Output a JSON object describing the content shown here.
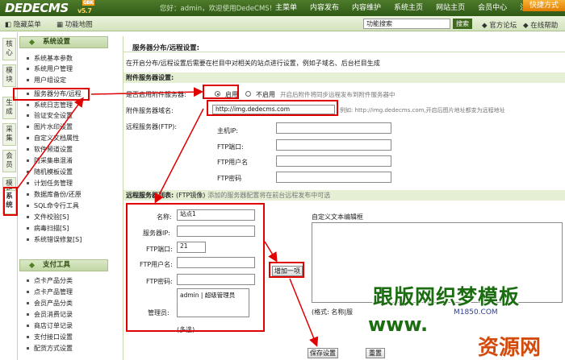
{
  "header": {
    "logo": "DEDECMS",
    "version": "v5.7",
    "badge": "GBK",
    "welcome": "您好：admin，欢迎使用DedeCMS!",
    "nav": [
      "主菜单",
      "内容发布",
      "内容维护",
      "系统主页",
      "网站主页",
      "会员中心",
      "注销"
    ],
    "quick_btn": "快捷方式"
  },
  "toolbar": {
    "hide_menu": "隐藏菜单",
    "func_map": "功能地图",
    "search_value": "功能搜索",
    "search_btn": "搜索",
    "forum": "官方论坛",
    "help": "在线帮助"
  },
  "vtabs": [
    "核心",
    "模块",
    "生成",
    "采集",
    "会员",
    "模板",
    "系统"
  ],
  "sidebar": {
    "sections": [
      {
        "title": "系统设置",
        "items": [
          "系统基本参数",
          "系统用户管理",
          "用户组设定",
          "服务器分布/远程",
          "系统日志管理",
          "验证安全设置",
          "图片水印设置",
          "自定义文档属性",
          "软件频道设置",
          "防采集串混淆",
          "随机模板设置",
          "计划任务管理",
          "数据库备份/还原",
          "SQL命令行工具",
          "文件校验[S]",
          "病毒扫描[S]",
          "系统错误修复[S]"
        ]
      },
      {
        "title": "支付工具",
        "items": [
          "点卡产品分类",
          "点卡产品管理",
          "会员产品分类",
          "会员消费记录",
          "商店订单记录",
          "支付接口设置",
          "配货方式设置"
        ]
      }
    ]
  },
  "main": {
    "title": "服务器分布/远程设置:",
    "desc": "在开启分布/远程设置后需要在栏目中对相关的站点进行设置，例如子域名、后台栏目生成",
    "attach_head": "附件服务器设置:",
    "enable_q": "是否启用附件服务器:",
    "enable_on": "启用",
    "enable_off": "不启用",
    "enable_hint": "开启后附件将同步远程发布到附件服务器中",
    "domain_label": "附件服务器域名:",
    "domain_value": "http://img.dedecms.com",
    "domain_hint": "例如: http://img.dedecms.com,开启后图片地址都变为远程地址",
    "remote_label": "远程服务器(FTP):",
    "host_label": "主机IP:",
    "port_label": "FTP端口:",
    "user_label": "FTP用户名",
    "pass_label": "FTP密码",
    "list_head": "远程服务器列表:",
    "list_mirror": "(FTP镜像)",
    "list_hint": "添加的服务器配置将在前台远程发布中可选",
    "name_label": "名称:",
    "name_value": "站点1",
    "srv_ip_label": "服务器IP:",
    "ftp_port_label": "FTP端口:",
    "ftp_port_value": "21",
    "ftp_user_label": "FTP用户名:",
    "ftp_pass_label": "FTP密码:",
    "admin_label": "管理员:",
    "admin_value": "admin | 超级管理员",
    "multi_hint": "(多选)",
    "add_btn": "增加一项",
    "editor_label": "自定义文本编辑框",
    "format_hint": "(格式: 名称|服",
    "save_btn": "保存设置",
    "reset_btn": "重置"
  },
  "watermark": {
    "line1": "跟版网织梦模板",
    "line2": "www.",
    "line3": "M1850.COM",
    "line4": "资源网"
  },
  "colors": {
    "header_green": "#2f5a16",
    "annotation_red": "#e00000",
    "accent_orange": "#f7a21a"
  }
}
